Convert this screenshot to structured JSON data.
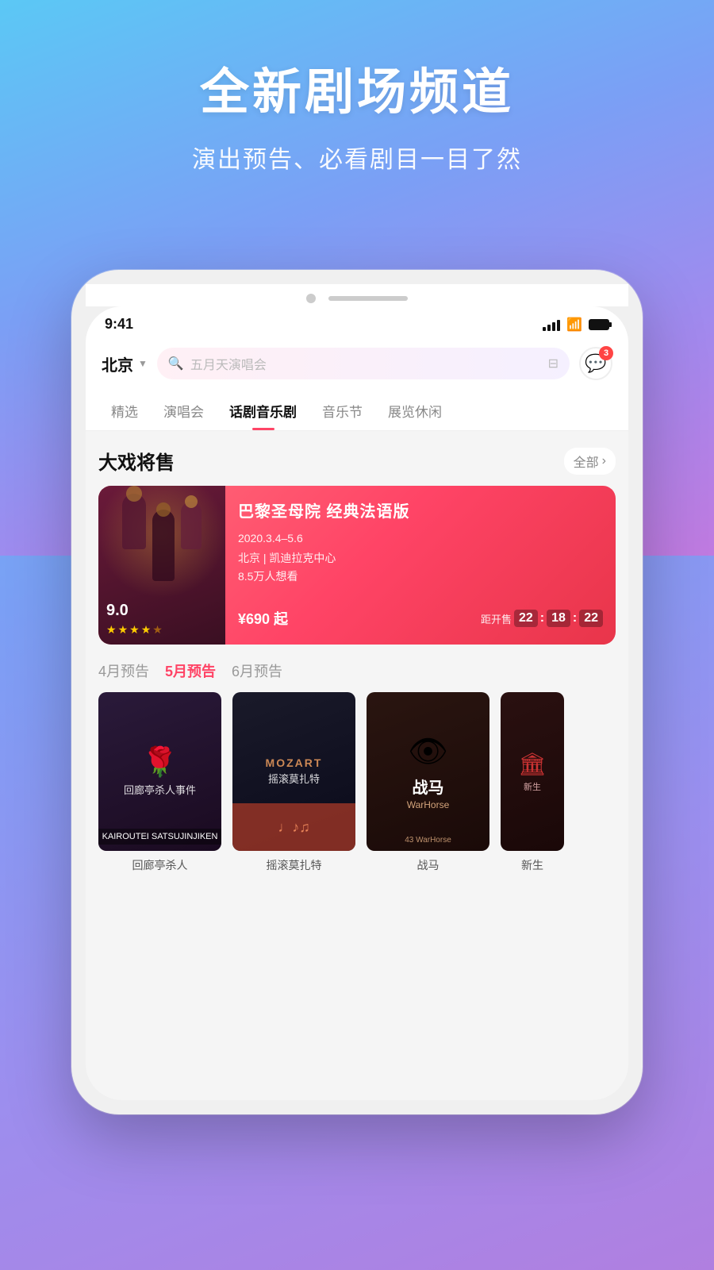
{
  "hero": {
    "title": "全新剧场频道",
    "subtitle": "演出预告、必看剧目一目了然"
  },
  "status_bar": {
    "time": "9:41",
    "badge": "3"
  },
  "header": {
    "city": "北京",
    "search_placeholder": "五月天演唱会",
    "message_badge": "3"
  },
  "nav_tabs": [
    {
      "label": "精选",
      "active": false
    },
    {
      "label": "演唱会",
      "active": false
    },
    {
      "label": "话剧音乐剧",
      "active": true
    },
    {
      "label": "音乐节",
      "active": false
    },
    {
      "label": "展览休闲",
      "active": false
    }
  ],
  "featured_section": {
    "title": "大戏将售",
    "more_label": "全部",
    "card": {
      "name": "巴黎圣母院 经典法语版",
      "date": "2020.3.4–5.6",
      "venue": "北京 | 凯迪拉克中心",
      "want_count": "8.5万人想看",
      "rating": "9.0",
      "price": "¥690 起",
      "countdown_label": "距开售",
      "countdown": [
        "22",
        "18",
        "22"
      ]
    }
  },
  "preview_tabs": [
    {
      "label": "4月预告",
      "active": false
    },
    {
      "label": "5月预告",
      "active": true
    },
    {
      "label": "6月预告",
      "active": false
    }
  ],
  "movie_cards": [
    {
      "title_cn": "回廊亭杀人事件",
      "title_en": "KAIROUTEI SATSUJINJIKEN",
      "label": "回廊亭杀人"
    },
    {
      "title_cn": "摇滚莫扎特",
      "title_en": "MOZART",
      "label": "摇滚莫扎特"
    },
    {
      "title_cn": "战马",
      "title_en": "43 WarHorse",
      "label": "战马"
    },
    {
      "title_cn": "新生",
      "title_en": "",
      "label": "新生"
    }
  ]
}
